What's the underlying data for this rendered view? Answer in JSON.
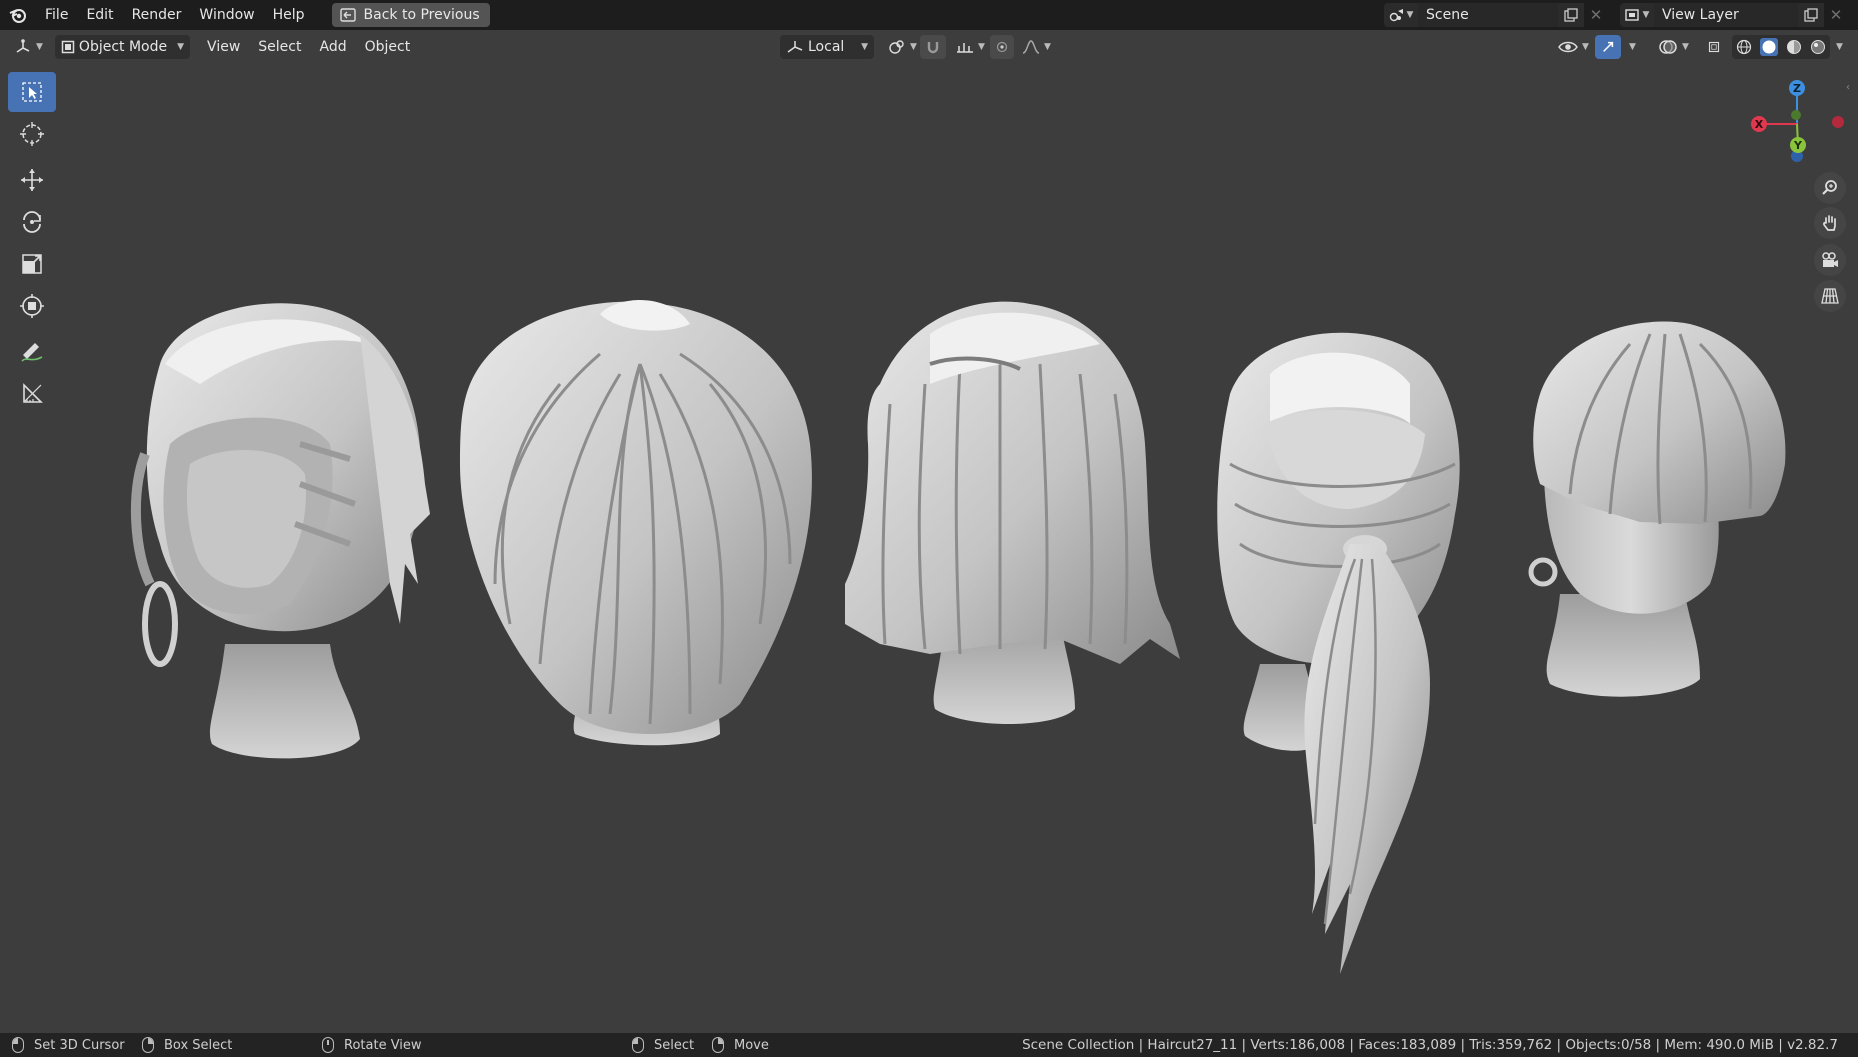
{
  "topbar": {
    "menus": [
      "File",
      "Edit",
      "Render",
      "Window",
      "Help"
    ],
    "back_button": "Back to Previous",
    "scene_name": "Scene",
    "view_layer": "View Layer"
  },
  "viewport_header": {
    "mode": "Object Mode",
    "menus": [
      "View",
      "Select",
      "Add",
      "Object"
    ],
    "transform_orientation": "Local"
  },
  "toolbar": {
    "tools": [
      "select-box",
      "cursor",
      "move",
      "rotate",
      "scale",
      "transform",
      "annotate",
      "measure"
    ],
    "active_tool": "select-box"
  },
  "gizmo": {
    "axes": [
      "X",
      "Y",
      "Z"
    ],
    "colors": {
      "x": "#e0394f",
      "y": "#8ac43c",
      "z": "#3d8fe0"
    }
  },
  "viewport": {
    "models": [
      "haircut-side-swept-with-hoop-earring",
      "haircut-shaggy-layered",
      "haircut-bob",
      "haircut-ponytail",
      "haircut-bowl-with-ring-earring"
    ],
    "background": "#3d3d3d",
    "model_color": "#cfcfcf"
  },
  "statusbar": {
    "hints": [
      {
        "label": "Set 3D Cursor",
        "mouse": "l"
      },
      {
        "label": "Box Select",
        "mouse": "r"
      },
      {
        "label": "Rotate View",
        "mouse": "m"
      },
      {
        "label": "Select",
        "mouse": "l"
      },
      {
        "label": "Move",
        "mouse": "r"
      }
    ],
    "stats": "Scene Collection | Haircut27_11 | Verts:186,008 | Faces:183,089 | Tris:359,762 | Objects:0/58 | Mem: 490.0 MiB | v2.82.7"
  }
}
